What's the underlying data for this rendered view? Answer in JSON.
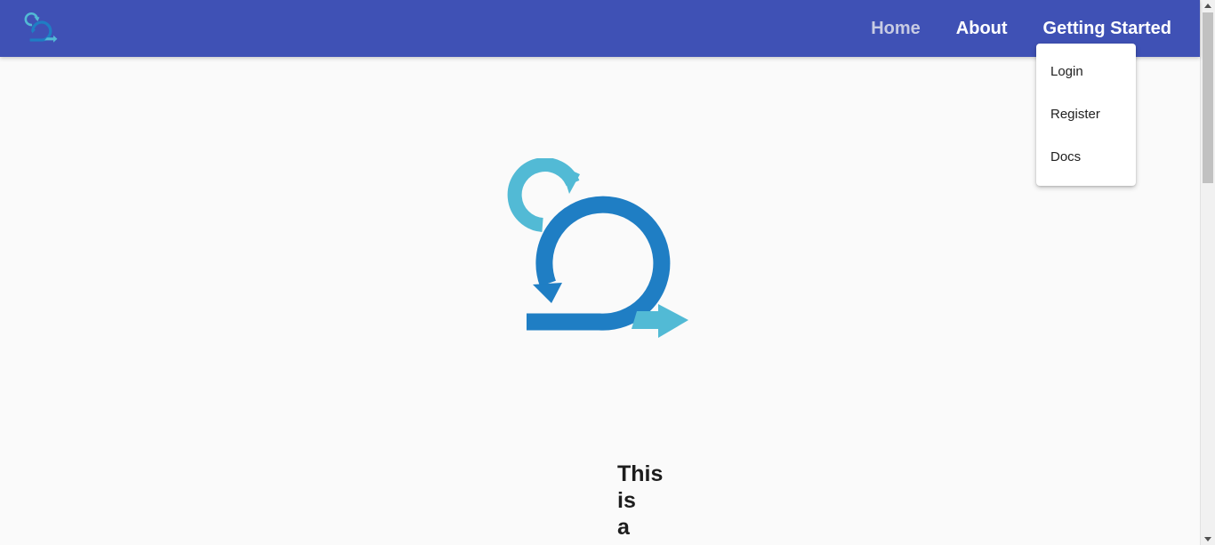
{
  "colors": {
    "appbar": "#3f51b5",
    "logo_light": "#52bad5",
    "logo_dark": "#1f7ec4"
  },
  "header": {
    "logo_icon": "scrum-cycle-logo-icon",
    "nav": [
      {
        "label": "Home",
        "active": true
      },
      {
        "label": "About"
      },
      {
        "label": "Getting Started",
        "expanded": true
      }
    ]
  },
  "dropdown": {
    "items": [
      {
        "label": "Login"
      },
      {
        "label": "Register"
      },
      {
        "label": "Docs"
      }
    ]
  },
  "hero": {
    "logo_icon": "scrum-cycle-logo-icon",
    "heading": "This is a"
  }
}
